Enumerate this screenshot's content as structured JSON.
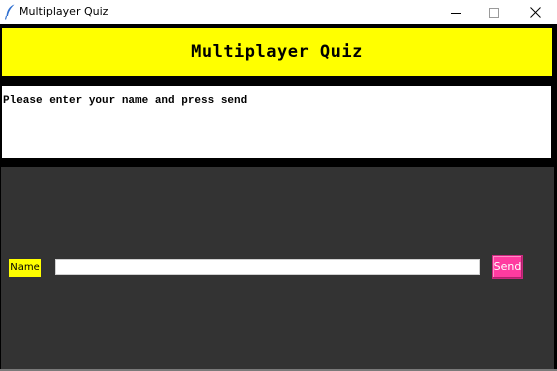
{
  "window": {
    "title": "Multiplayer Quiz",
    "icon": "feather-icon",
    "controls": [
      "minimize-icon",
      "maximize-icon",
      "close-icon"
    ]
  },
  "header": {
    "title": "Multiplayer Quiz"
  },
  "messages": {
    "text": "Please enter your name and press send"
  },
  "form": {
    "name_label": "Name",
    "name_value": "",
    "name_placeholder": "",
    "send_label": "Send"
  },
  "colors": {
    "header_bg": "#ffff00",
    "panel_bg": "#333333",
    "send_bg": "#ff3ba0",
    "label_bg": "#ffff00"
  }
}
